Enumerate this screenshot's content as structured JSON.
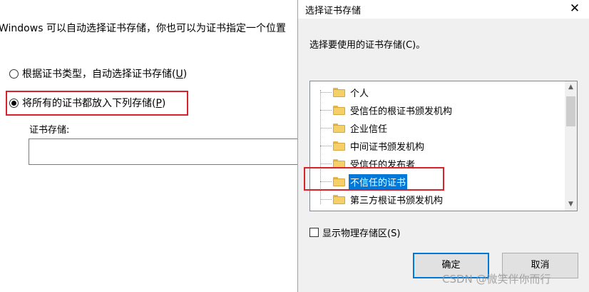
{
  "background": {
    "description": "Windows 可以自动选择证书存储，你也可以为证书指定一个位置",
    "radio_auto": {
      "label": "根据证书类型，自动选择证书存储(",
      "accel": "U",
      "close": ")",
      "checked": false
    },
    "radio_all": {
      "label": "将所有的证书都放入下列存储(",
      "accel": "P",
      "close": ")",
      "checked": true
    },
    "store_label": "证书存储:",
    "store_value": ""
  },
  "dialog": {
    "title": "选择证书存储",
    "close_icon": "close-icon",
    "prompt": "选择要使用的证书存储(C)。",
    "tree_items": [
      {
        "label": "个人",
        "selected": false
      },
      {
        "label": "受信任的根证书颁发机构",
        "selected": false
      },
      {
        "label": "企业信任",
        "selected": false
      },
      {
        "label": "中间证书颁发机构",
        "selected": false
      },
      {
        "label": "受信任的发布者",
        "selected": false
      },
      {
        "label": "不信任的证书",
        "selected": true
      },
      {
        "label": "第三方根证书颁发机构",
        "selected": false
      }
    ],
    "show_physical_label": "显示物理存储区(S)",
    "show_physical_checked": false,
    "ok_label": "确定",
    "cancel_label": "取消"
  },
  "watermark": "CSDN @微笑伴你而行",
  "colors": {
    "selection": "#0078d7",
    "highlight_box": "#d9222a"
  }
}
